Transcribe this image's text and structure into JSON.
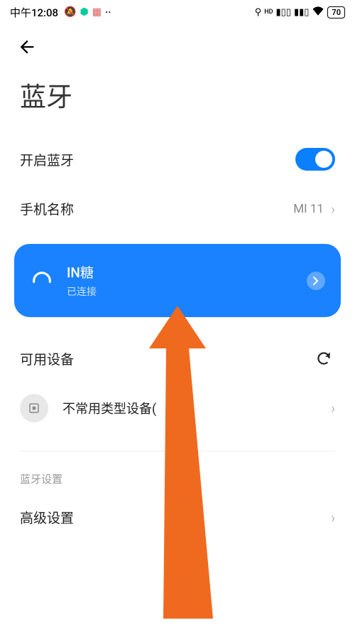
{
  "status": {
    "time": "中午12:08",
    "battery": "70"
  },
  "page": {
    "title": "蓝牙"
  },
  "bluetooth_toggle": {
    "label": "开启蓝牙",
    "on": true
  },
  "phone_name": {
    "label": "手机名称",
    "value": "MI 11"
  },
  "connected_device": {
    "name": "IN糖",
    "status": "已连接"
  },
  "available": {
    "title": "可用设备"
  },
  "uncommon": {
    "label": "不常用类型设备("
  },
  "bt_settings_hint": "蓝牙设置",
  "advanced": {
    "label": "高级设置"
  }
}
